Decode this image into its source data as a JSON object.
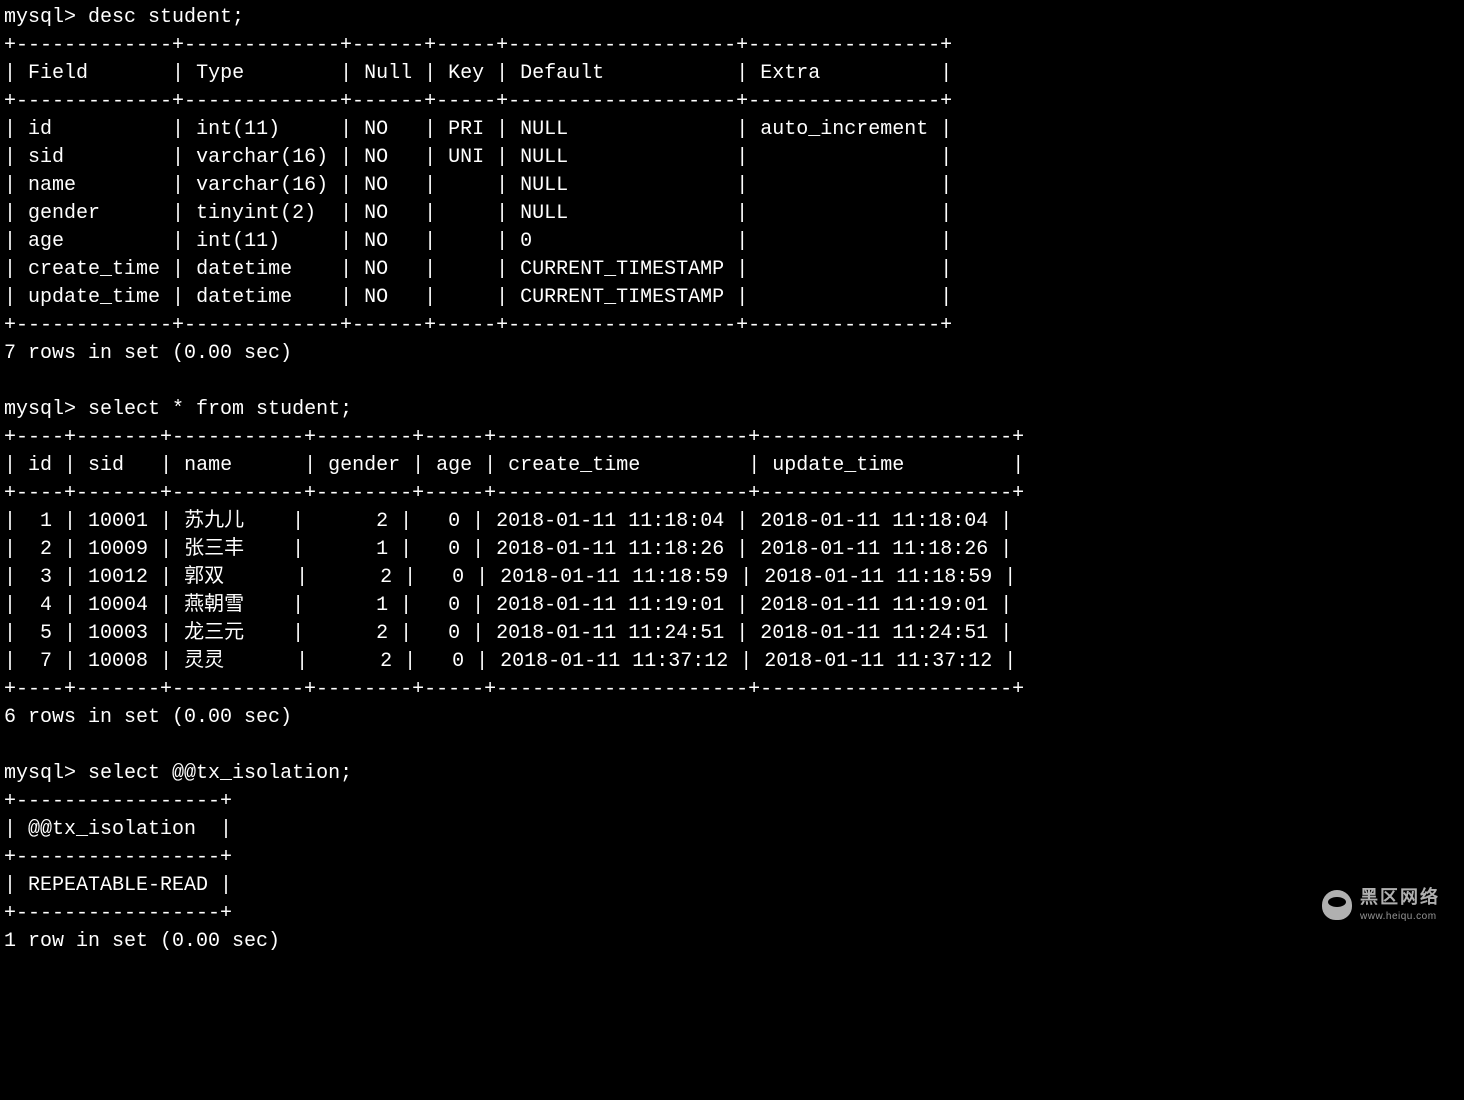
{
  "prompt": "mysql>",
  "commands": {
    "c1": "desc student;",
    "c2": "select * from student;",
    "c3": "select @@tx_isolation;"
  },
  "desc_table": {
    "border_top": "+-------------+-------------+------+-----+-------------------+----------------+",
    "headers": {
      "field": "Field",
      "type": "Type",
      "null": "Null",
      "key": "Key",
      "default": "Default",
      "extra": "Extra"
    },
    "rows": [
      {
        "field": "id",
        "type": "int(11)",
        "null": "NO",
        "key": "PRI",
        "default": "NULL",
        "extra": "auto_increment"
      },
      {
        "field": "sid",
        "type": "varchar(16)",
        "null": "NO",
        "key": "UNI",
        "default": "NULL",
        "extra": ""
      },
      {
        "field": "name",
        "type": "varchar(16)",
        "null": "NO",
        "key": "",
        "default": "NULL",
        "extra": ""
      },
      {
        "field": "gender",
        "type": "tinyint(2)",
        "null": "NO",
        "key": "",
        "default": "NULL",
        "extra": ""
      },
      {
        "field": "age",
        "type": "int(11)",
        "null": "NO",
        "key": "",
        "default": "0",
        "extra": ""
      },
      {
        "field": "create_time",
        "type": "datetime",
        "null": "NO",
        "key": "",
        "default": "CURRENT_TIMESTAMP",
        "extra": ""
      },
      {
        "field": "update_time",
        "type": "datetime",
        "null": "NO",
        "key": "",
        "default": "CURRENT_TIMESTAMP",
        "extra": ""
      }
    ],
    "summary": "7 rows in set (0.00 sec)"
  },
  "select_table": {
    "border_top": "+----+-------+-----------+--------+-----+---------------------+---------------------+",
    "headers": {
      "id": "id",
      "sid": "sid",
      "name": "name",
      "gender": "gender",
      "age": "age",
      "create_time": "create_time",
      "update_time": "update_time"
    },
    "rows": [
      {
        "id": "1",
        "sid": "10001",
        "name": "苏九儿",
        "gender": "2",
        "age": "0",
        "create_time": "2018-01-11 11:18:04",
        "update_time": "2018-01-11 11:18:04"
      },
      {
        "id": "2",
        "sid": "10009",
        "name": "张三丰",
        "gender": "1",
        "age": "0",
        "create_time": "2018-01-11 11:18:26",
        "update_time": "2018-01-11 11:18:26"
      },
      {
        "id": "3",
        "sid": "10012",
        "name": "郭双",
        "gender": "2",
        "age": "0",
        "create_time": "2018-01-11 11:18:59",
        "update_time": "2018-01-11 11:18:59"
      },
      {
        "id": "4",
        "sid": "10004",
        "name": "燕朝雪",
        "gender": "1",
        "age": "0",
        "create_time": "2018-01-11 11:19:01",
        "update_time": "2018-01-11 11:19:01"
      },
      {
        "id": "5",
        "sid": "10003",
        "name": "龙三元",
        "gender": "2",
        "age": "0",
        "create_time": "2018-01-11 11:24:51",
        "update_time": "2018-01-11 11:24:51"
      },
      {
        "id": "7",
        "sid": "10008",
        "name": "灵灵",
        "gender": "2",
        "age": "0",
        "create_time": "2018-01-11 11:37:12",
        "update_time": "2018-01-11 11:37:12"
      }
    ],
    "summary": "6 rows in set (0.00 sec)"
  },
  "iso_table": {
    "border": "+-----------------+",
    "header": "@@tx_isolation",
    "value": "REPEATABLE-READ",
    "summary": "1 row in set (0.00 sec)"
  },
  "watermark": {
    "line1": "黑区网络",
    "line2": "www.heiqu.com"
  }
}
